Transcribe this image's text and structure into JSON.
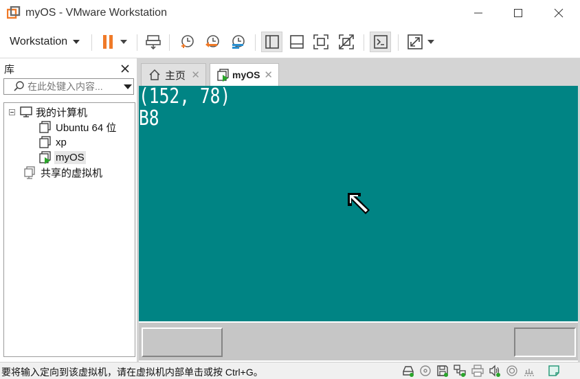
{
  "window": {
    "title": "myOS - VMware Workstation"
  },
  "toolbar": {
    "menu_label": "Workstation",
    "buttons": [
      "pause-icon",
      "send-ctrl-alt-del-icon",
      "snapshot-take-icon",
      "snapshot-revert-icon",
      "snapshot-manager-icon",
      "view-library-icon",
      "view-thumbnail-icon",
      "fullscreen-icon",
      "unity-icon",
      "console-icon",
      "stretch-icon"
    ],
    "pause_color": "#f07a28"
  },
  "library": {
    "title": "库",
    "search_placeholder": "在此处键入内容...",
    "tree": [
      {
        "label": "我的计算机",
        "icon": "computer-icon",
        "level": 0
      },
      {
        "label": "Ubuntu 64 位",
        "icon": "vm-icon",
        "level": 1
      },
      {
        "label": "xp",
        "icon": "vm-icon",
        "level": 1
      },
      {
        "label": "myOS",
        "icon": "vm-running-icon",
        "level": 1,
        "selected": true
      },
      {
        "label": "共享的虚拟机",
        "icon": "shared-vm-icon",
        "level": 0
      }
    ]
  },
  "tabs": [
    {
      "label": "主页",
      "icon": "home-icon",
      "active": false
    },
    {
      "label": "myOS",
      "icon": "vm-running-icon",
      "active": true
    }
  ],
  "vm": {
    "background": "#008484",
    "lines": [
      "(152, 78)",
      "B8"
    ]
  },
  "statusbar": {
    "text": "要将输入定向到该虚拟机，请在虚拟机内部单击或按 Ctrl+G。",
    "icons": [
      "hard-disk-icon",
      "cd-icon",
      "floppy-icon",
      "network-icon",
      "printer-icon",
      "sound-icon",
      "usb-icon",
      "message-icon"
    ]
  }
}
